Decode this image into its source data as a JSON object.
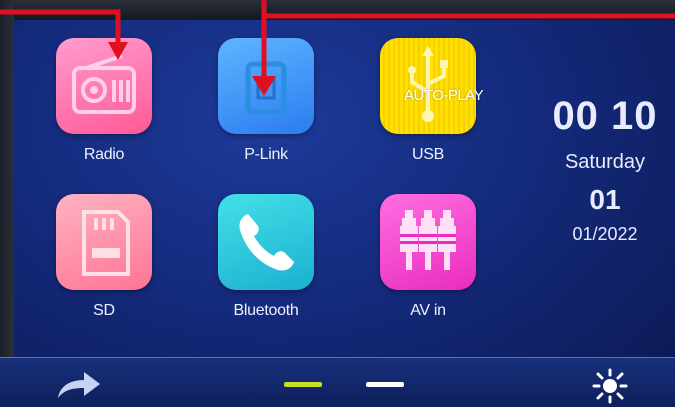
{
  "apps": [
    {
      "label": "Radio",
      "icon": "radio-icon"
    },
    {
      "label": "P-Link",
      "icon": "phone-link-icon"
    },
    {
      "label": "USB",
      "icon": "usb-icon"
    },
    {
      "label": "SD",
      "icon": "sd-card-icon"
    },
    {
      "label": "Bluetooth",
      "icon": "phone-icon"
    },
    {
      "label": "AV in",
      "icon": "av-connector-icon"
    }
  ],
  "overlay_text": "AUTO-PLAY",
  "clock": {
    "time": "00 10",
    "day": "Saturday",
    "date_num": "01",
    "date_full": "01/2022"
  },
  "bottom": {
    "back_icon": "forward-arrow-icon",
    "brightness_icon": "brightness-icon",
    "page_indicator": {
      "pages": 2,
      "active": 1
    }
  },
  "colors": {
    "radio": "#ff6fa8",
    "plink": "#3e9cff",
    "usb": "#ffd800",
    "sd": "#ff8aa6",
    "bluetooth": "#28d0e0",
    "avin": "#ff3fd0",
    "annotation": "#e01020",
    "indicator_active": "#c8e020",
    "indicator_inactive": "#ffffff"
  }
}
